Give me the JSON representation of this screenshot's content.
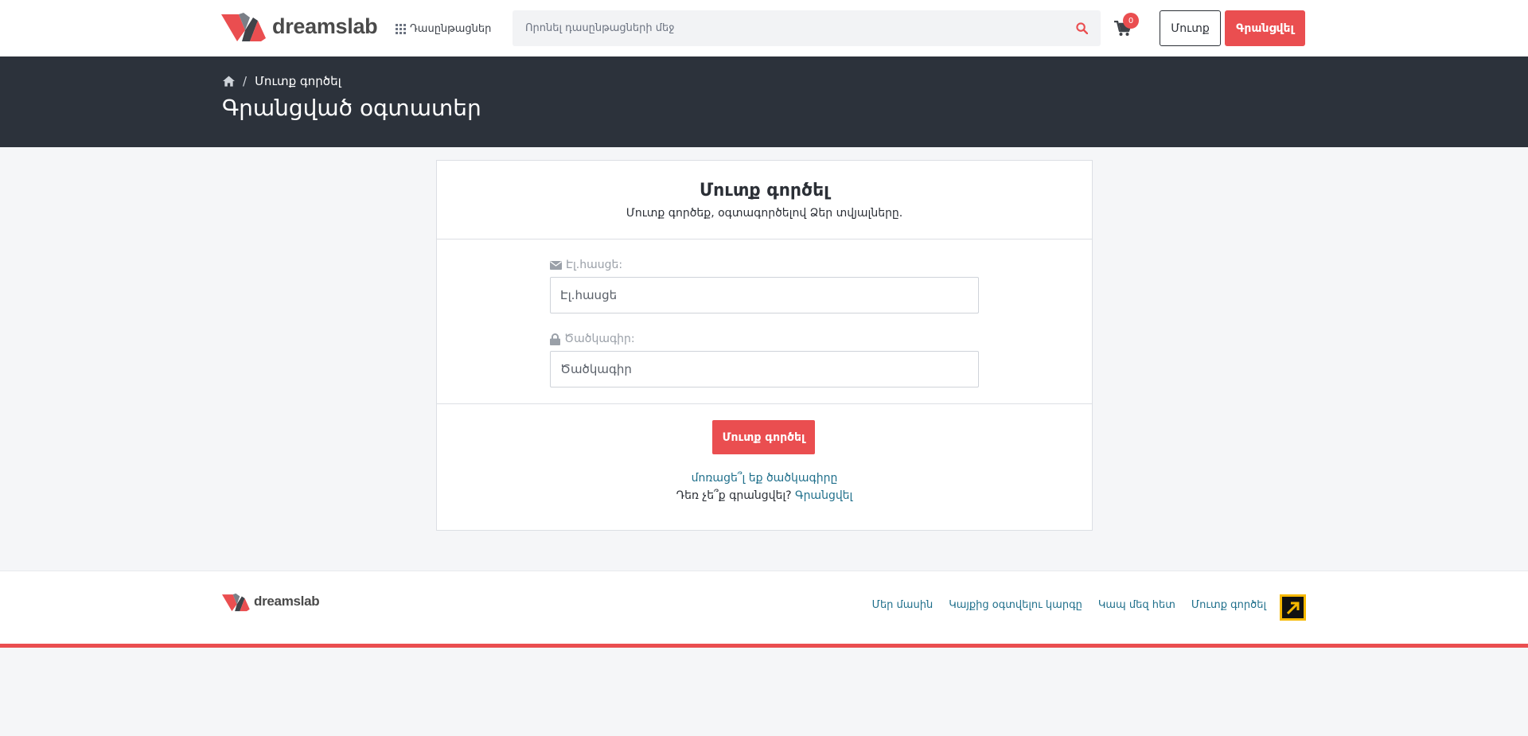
{
  "header": {
    "logo_text": "dreamslab",
    "courses_label": "Դասընթացներ",
    "search_placeholder": "Որոնել դասընթացների մեջ",
    "cart_count": "0",
    "login_label": "Մուտք",
    "register_label": "Գրանցվել"
  },
  "hero": {
    "breadcrumb_current": "Մուտք գործել",
    "title": "Գրանցված օգտատեր"
  },
  "login_card": {
    "title": "Մուտք գործել",
    "subtitle": "Մուտք գործեք, օգտագործելով Ձեր տվյալները.",
    "email_label": "Էլ.հասցե:",
    "email_placeholder": "Էլ.հասցե",
    "password_label": "Ծածկագիր:",
    "password_placeholder": "Ծածկագիր",
    "submit_label": "Մուտք գործել",
    "forgot_label": "մոռացե՞լ եք ծածկագիրը",
    "no_account_text": "Դեռ չե՞ք գրանցվել?",
    "signup_link": "Գրանցվել"
  },
  "footer": {
    "logo_text": "dreamslab",
    "links": [
      "Մեր մասին",
      "Կայքից օգտվելու կարգը",
      "Կապ մեզ հետ",
      "Մուտք գործել"
    ]
  },
  "colors": {
    "accent": "#ea4e50",
    "hero_bg": "#2c323b",
    "link": "#1f6f8b"
  }
}
